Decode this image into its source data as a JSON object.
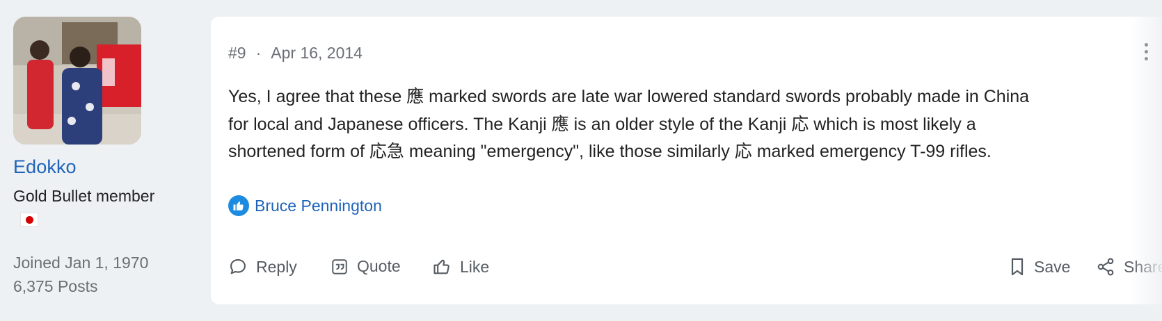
{
  "user": {
    "name": "Edokko",
    "rank": "Gold Bullet member",
    "joined": "Joined Jan 1, 1970",
    "posts": "6,375 Posts"
  },
  "post": {
    "number": "#9",
    "separator": "·",
    "date": "Apr 16, 2014",
    "lines": [
      "Yes, I agree that these 應 marked swords are late war lowered standard swords probably made in China",
      "for local and Japanese officers. The Kanji 應 is an older style of the Kanji 応 which is most likely a",
      "shortened form of 応急 meaning \"emergency\", like those similarly 応 marked emergency T-99 rifles."
    ],
    "reactions": {
      "icon": "thumbs-up-icon",
      "users": "Bruce Pennington"
    }
  },
  "actions": {
    "reply": "Reply",
    "quote": "Quote",
    "like": "Like",
    "save": "Save",
    "share": "Share"
  },
  "colors": {
    "background": "#eef1f4",
    "link": "#1e63b8",
    "like_badge": "#1d8be0",
    "flag_red": "#d40000"
  }
}
